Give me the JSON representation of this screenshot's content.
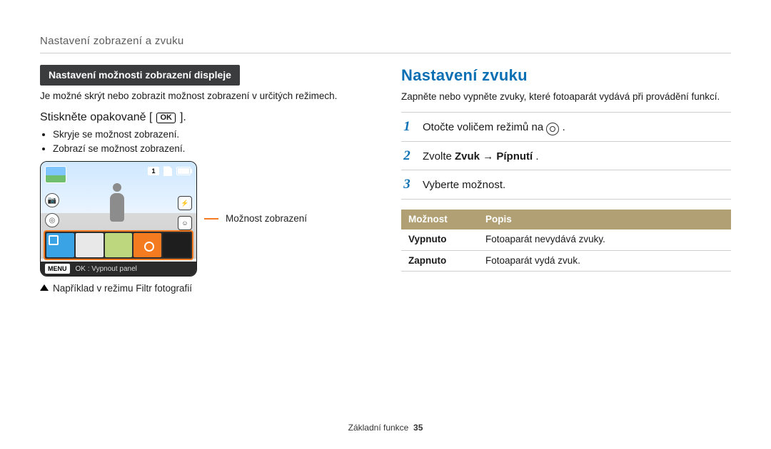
{
  "breadcrumb": "Nastavení zobrazení a zvuku",
  "left": {
    "pill": "Nastavení možnosti zobrazení displeje",
    "intro": "Je možné skrýt nebo zobrazit možnost zobrazení v určitých režimech.",
    "step_prefix": "Stiskněte opakovaně [",
    "ok_label": "OK",
    "step_suffix": "].",
    "bullets": [
      "Skryje se možnost zobrazení.",
      "Zobrazí se možnost zobrazení."
    ],
    "screenshot": {
      "counter": "1",
      "menu_label": "MENU",
      "footer_text": "OK : Vypnout panel"
    },
    "callout": "Možnost zobrazení",
    "caption": "Například v režimu Filtr fotografií"
  },
  "right": {
    "heading": "Nastavení zvuku",
    "intro": "Zapněte nebo vypněte zvuky, které fotoaparát vydává při provádění funkcí.",
    "steps": [
      {
        "n": "1",
        "prefix": "Otočte voličem režimů na ",
        "icon": "gear",
        "suffix": " ."
      },
      {
        "n": "2",
        "prefix": "Zvolte ",
        "bold": "Zvuk",
        "mid": " → ",
        "bold2": "Pípnutí",
        "suffix": "."
      },
      {
        "n": "3",
        "prefix": "Vyberte možnost."
      }
    ],
    "table": {
      "headers": [
        "Možnost",
        "Popis"
      ],
      "rows": [
        [
          "Vypnuto",
          "Fotoaparát nevydává zvuky."
        ],
        [
          "Zapnuto",
          "Fotoaparát vydá zvuk."
        ]
      ]
    }
  },
  "footer": {
    "section": "Základní funkce",
    "page": "35"
  }
}
